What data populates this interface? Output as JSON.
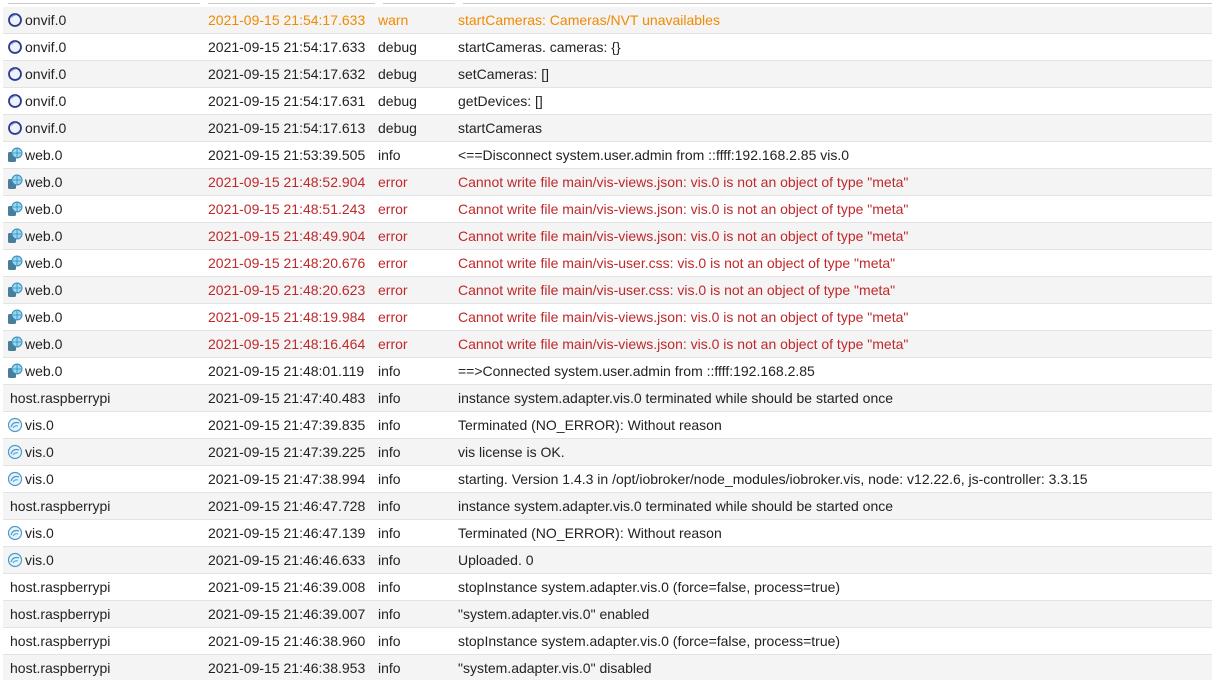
{
  "log": {
    "rows": [
      {
        "source": "onvif.0",
        "icon": "onvif-icon",
        "time": "2021-09-15 21:54:17.633",
        "severity": "warn",
        "message": "startCameras: Cameras/NVT unavailables"
      },
      {
        "source": "onvif.0",
        "icon": "onvif-icon",
        "time": "2021-09-15 21:54:17.633",
        "severity": "debug",
        "message": "startCameras. cameras: {}"
      },
      {
        "source": "onvif.0",
        "icon": "onvif-icon",
        "time": "2021-09-15 21:54:17.632",
        "severity": "debug",
        "message": "setCameras: []"
      },
      {
        "source": "onvif.0",
        "icon": "onvif-icon",
        "time": "2021-09-15 21:54:17.631",
        "severity": "debug",
        "message": "getDevices: []"
      },
      {
        "source": "onvif.0",
        "icon": "onvif-icon",
        "time": "2021-09-15 21:54:17.613",
        "severity": "debug",
        "message": "startCameras"
      },
      {
        "source": "web.0",
        "icon": "web-icon",
        "time": "2021-09-15 21:53:39.505",
        "severity": "info",
        "message": "<==Disconnect system.user.admin from ::ffff:192.168.2.85 vis.0"
      },
      {
        "source": "web.0",
        "icon": "web-icon",
        "time": "2021-09-15 21:48:52.904",
        "severity": "error",
        "message": "Cannot write file main/vis-views.json: vis.0 is not an object of type \"meta\""
      },
      {
        "source": "web.0",
        "icon": "web-icon",
        "time": "2021-09-15 21:48:51.243",
        "severity": "error",
        "message": "Cannot write file main/vis-views.json: vis.0 is not an object of type \"meta\""
      },
      {
        "source": "web.0",
        "icon": "web-icon",
        "time": "2021-09-15 21:48:49.904",
        "severity": "error",
        "message": "Cannot write file main/vis-views.json: vis.0 is not an object of type \"meta\""
      },
      {
        "source": "web.0",
        "icon": "web-icon",
        "time": "2021-09-15 21:48:20.676",
        "severity": "error",
        "message": "Cannot write file main/vis-user.css: vis.0 is not an object of type \"meta\""
      },
      {
        "source": "web.0",
        "icon": "web-icon",
        "time": "2021-09-15 21:48:20.623",
        "severity": "error",
        "message": "Cannot write file main/vis-user.css: vis.0 is not an object of type \"meta\""
      },
      {
        "source": "web.0",
        "icon": "web-icon",
        "time": "2021-09-15 21:48:19.984",
        "severity": "error",
        "message": "Cannot write file main/vis-views.json: vis.0 is not an object of type \"meta\""
      },
      {
        "source": "web.0",
        "icon": "web-icon",
        "time": "2021-09-15 21:48:16.464",
        "severity": "error",
        "message": "Cannot write file main/vis-views.json: vis.0 is not an object of type \"meta\""
      },
      {
        "source": "web.0",
        "icon": "web-icon",
        "time": "2021-09-15 21:48:01.119",
        "severity": "info",
        "message": "==>Connected system.user.admin from ::ffff:192.168.2.85"
      },
      {
        "source": "host.raspberrypi",
        "icon": "",
        "time": "2021-09-15 21:47:40.483",
        "severity": "info",
        "message": "instance system.adapter.vis.0 terminated while should be started once"
      },
      {
        "source": "vis.0",
        "icon": "vis-icon",
        "time": "2021-09-15 21:47:39.835",
        "severity": "info",
        "message": "Terminated (NO_ERROR): Without reason"
      },
      {
        "source": "vis.0",
        "icon": "vis-icon",
        "time": "2021-09-15 21:47:39.225",
        "severity": "info",
        "message": "vis license is OK."
      },
      {
        "source": "vis.0",
        "icon": "vis-icon",
        "time": "2021-09-15 21:47:38.994",
        "severity": "info",
        "message": "starting. Version 1.4.3 in /opt/iobroker/node_modules/iobroker.vis, node: v12.22.6, js-controller: 3.3.15"
      },
      {
        "source": "host.raspberrypi",
        "icon": "",
        "time": "2021-09-15 21:46:47.728",
        "severity": "info",
        "message": "instance system.adapter.vis.0 terminated while should be started once"
      },
      {
        "source": "vis.0",
        "icon": "vis-icon",
        "time": "2021-09-15 21:46:47.139",
        "severity": "info",
        "message": "Terminated (NO_ERROR): Without reason"
      },
      {
        "source": "vis.0",
        "icon": "vis-icon",
        "time": "2021-09-15 21:46:46.633",
        "severity": "info",
        "message": "Uploaded. 0"
      },
      {
        "source": "host.raspberrypi",
        "icon": "",
        "time": "2021-09-15 21:46:39.008",
        "severity": "info",
        "message": "stopInstance system.adapter.vis.0 (force=false, process=true)"
      },
      {
        "source": "host.raspberrypi",
        "icon": "",
        "time": "2021-09-15 21:46:39.007",
        "severity": "info",
        "message": "\"system.adapter.vis.0\" enabled"
      },
      {
        "source": "host.raspberrypi",
        "icon": "",
        "time": "2021-09-15 21:46:38.960",
        "severity": "info",
        "message": "stopInstance system.adapter.vis.0 (force=false, process=true)"
      },
      {
        "source": "host.raspberrypi",
        "icon": "",
        "time": "2021-09-15 21:46:38.953",
        "severity": "info",
        "message": "\"system.adapter.vis.0\" disabled"
      }
    ]
  },
  "colors": {
    "warn": "#f08a00",
    "error": "#c0282a",
    "row_alt": "#f4f4f4"
  }
}
